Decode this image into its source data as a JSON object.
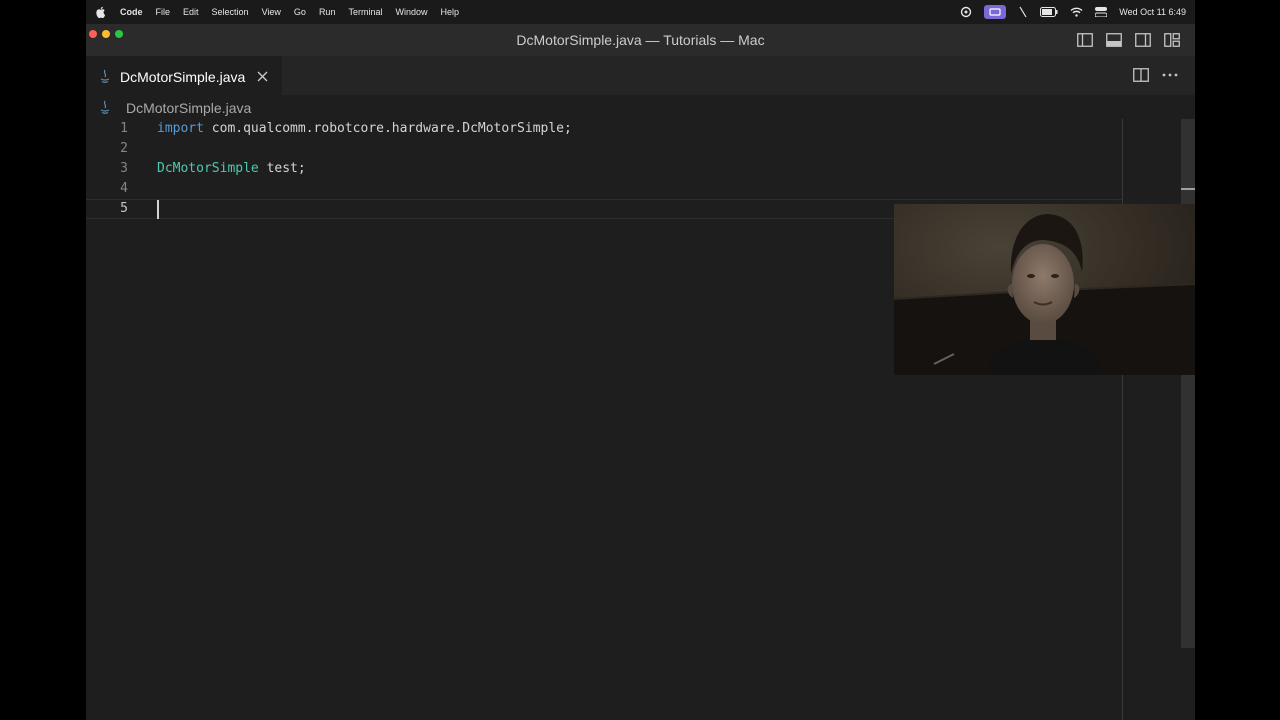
{
  "menubar": {
    "app_name": "Code",
    "items": [
      "File",
      "Edit",
      "Selection",
      "View",
      "Go",
      "Run",
      "Terminal",
      "Window",
      "Help"
    ],
    "clock": "Wed Oct 11  6:49",
    "status_icons": [
      "wifi-icon",
      "battery-icon",
      "control-center-icon"
    ]
  },
  "window": {
    "title": "DcMotorSimple.java — Tutorials — Mac"
  },
  "tab": {
    "label": "DcMotorSimple.java"
  },
  "breadcrumb": {
    "file": "DcMotorSimple.java"
  },
  "editor": {
    "lines": [
      {
        "number": "1",
        "tokens": [
          {
            "text": "import",
            "kind": "keyword"
          },
          {
            "text": " com.qualcomm.robotcore.hardware.DcMotorSimple;",
            "kind": "plain"
          }
        ]
      },
      {
        "number": "2",
        "tokens": []
      },
      {
        "number": "3",
        "tokens": [
          {
            "text": "DcMotorSimple",
            "kind": "type"
          },
          {
            "text": " test;",
            "kind": "plain"
          }
        ]
      },
      {
        "number": "4",
        "tokens": []
      },
      {
        "number": "5",
        "tokens": []
      }
    ]
  },
  "colors": {
    "editor_bg": "#1e1e1e",
    "keyword": "#569cd6",
    "type": "#4ec9b0",
    "text": "#d4d4d4",
    "line_number": "#858585"
  }
}
